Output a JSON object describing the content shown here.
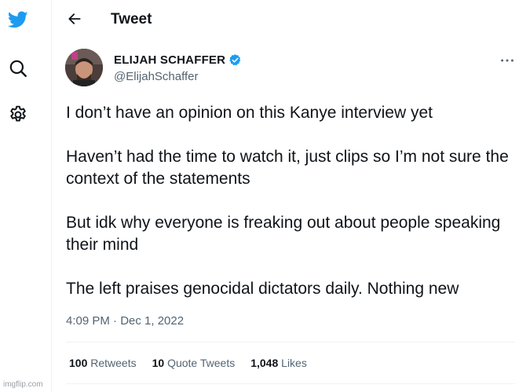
{
  "header": {
    "title": "Tweet"
  },
  "tweet": {
    "author_name": "ELIJAH SCHAFFER",
    "handle": "@ElijahSchaffer",
    "paragraphs": [
      "I don’t have an opinion on this Kanye interview yet",
      "Haven’t had the time to watch it, just clips so I’m not sure the context of the statements",
      "But idk why everyone is freaking out about people speaking their mind",
      "The left praises genocidal dictators daily. Nothing new"
    ],
    "timestamp": "4:09 PM · Dec 1, 2022"
  },
  "stats": {
    "retweets_count": "100",
    "retweets_label": "Retweets",
    "quotes_count": "10",
    "quotes_label": "Quote Tweets",
    "likes_count": "1,048",
    "likes_label": "Likes"
  },
  "watermark": "imgflip.com",
  "icons": {
    "logo": "twitter-bird-icon",
    "search": "search-icon",
    "settings": "gear-icon",
    "back": "back-arrow-icon",
    "verified": "verified-badge-icon",
    "more": "more-horizontal-icon"
  },
  "colors": {
    "brand": "#1d9bf0",
    "text": "#0f1419",
    "muted": "#536471",
    "divider": "#eff3f4"
  }
}
